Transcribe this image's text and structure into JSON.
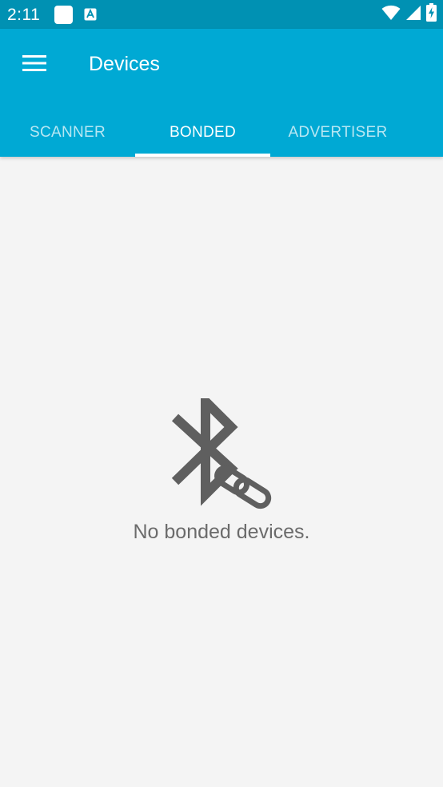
{
  "status_bar": {
    "time": "2:11",
    "icons": [
      "notification-square-icon",
      "notification-a-icon",
      "wifi-icon",
      "signal-icon",
      "battery-charging-icon"
    ]
  },
  "app_bar": {
    "title": "Devices",
    "menu_icon": "hamburger-menu-icon",
    "background_color": "#00a9d4"
  },
  "tabs": [
    {
      "label": "SCANNER",
      "active": false
    },
    {
      "label": "BONDED",
      "active": true
    },
    {
      "label": "ADVERTISER",
      "active": false
    }
  ],
  "empty_state": {
    "icon": "bluetooth-link-off-icon",
    "message": "No bonded devices."
  },
  "colors": {
    "status_bar": "#0091b3",
    "accent": "#00a9d4",
    "background": "#f4f4f4",
    "icon": "#5f5f5f"
  }
}
